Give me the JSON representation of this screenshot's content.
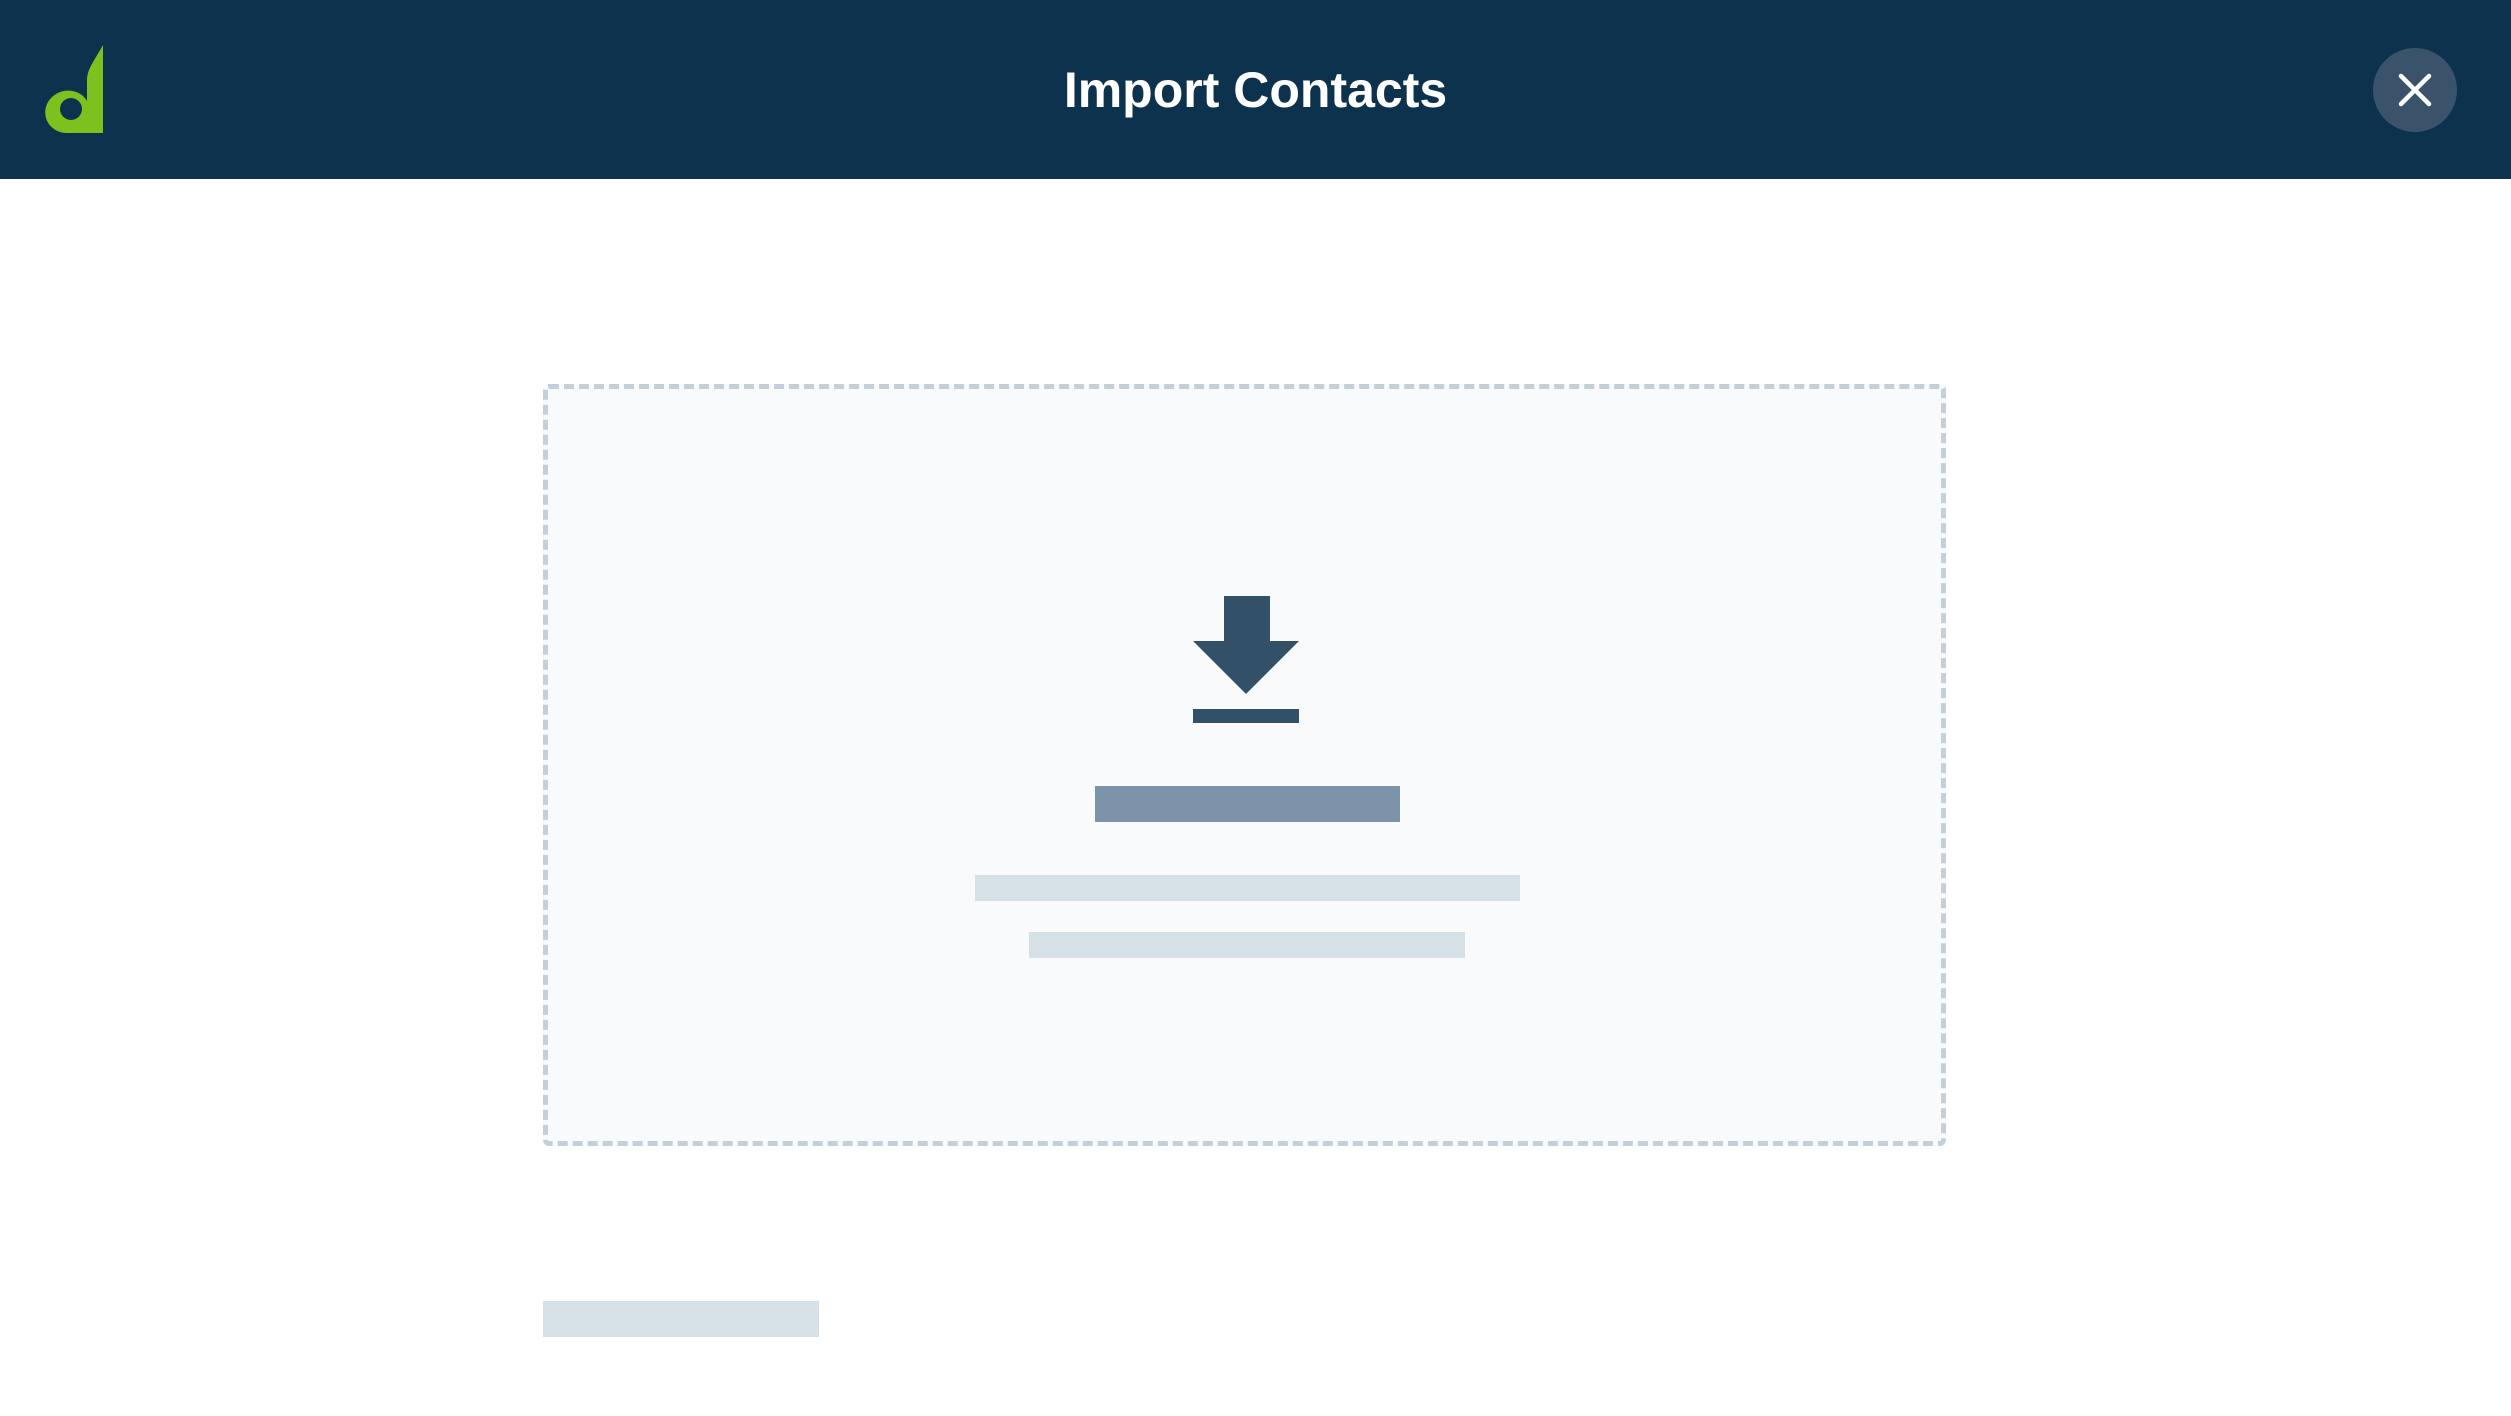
{
  "header": {
    "title": "Import Contacts",
    "logo_icon": "brand-leaf-d-logo",
    "close_icon": "close-icon",
    "background_color": "#0d324d",
    "logo_color": "#7dc11f"
  },
  "dropzone": {
    "icon": "download-arrow-icon",
    "icon_color": "#335069",
    "border_color": "#c3cfd9",
    "background_color": "#f8fafc",
    "heading_placeholder_color": "#7d93a9",
    "text_placeholder_color": "#d6e0e7"
  },
  "footer": {
    "placeholder_color": "#d6e0e7"
  }
}
